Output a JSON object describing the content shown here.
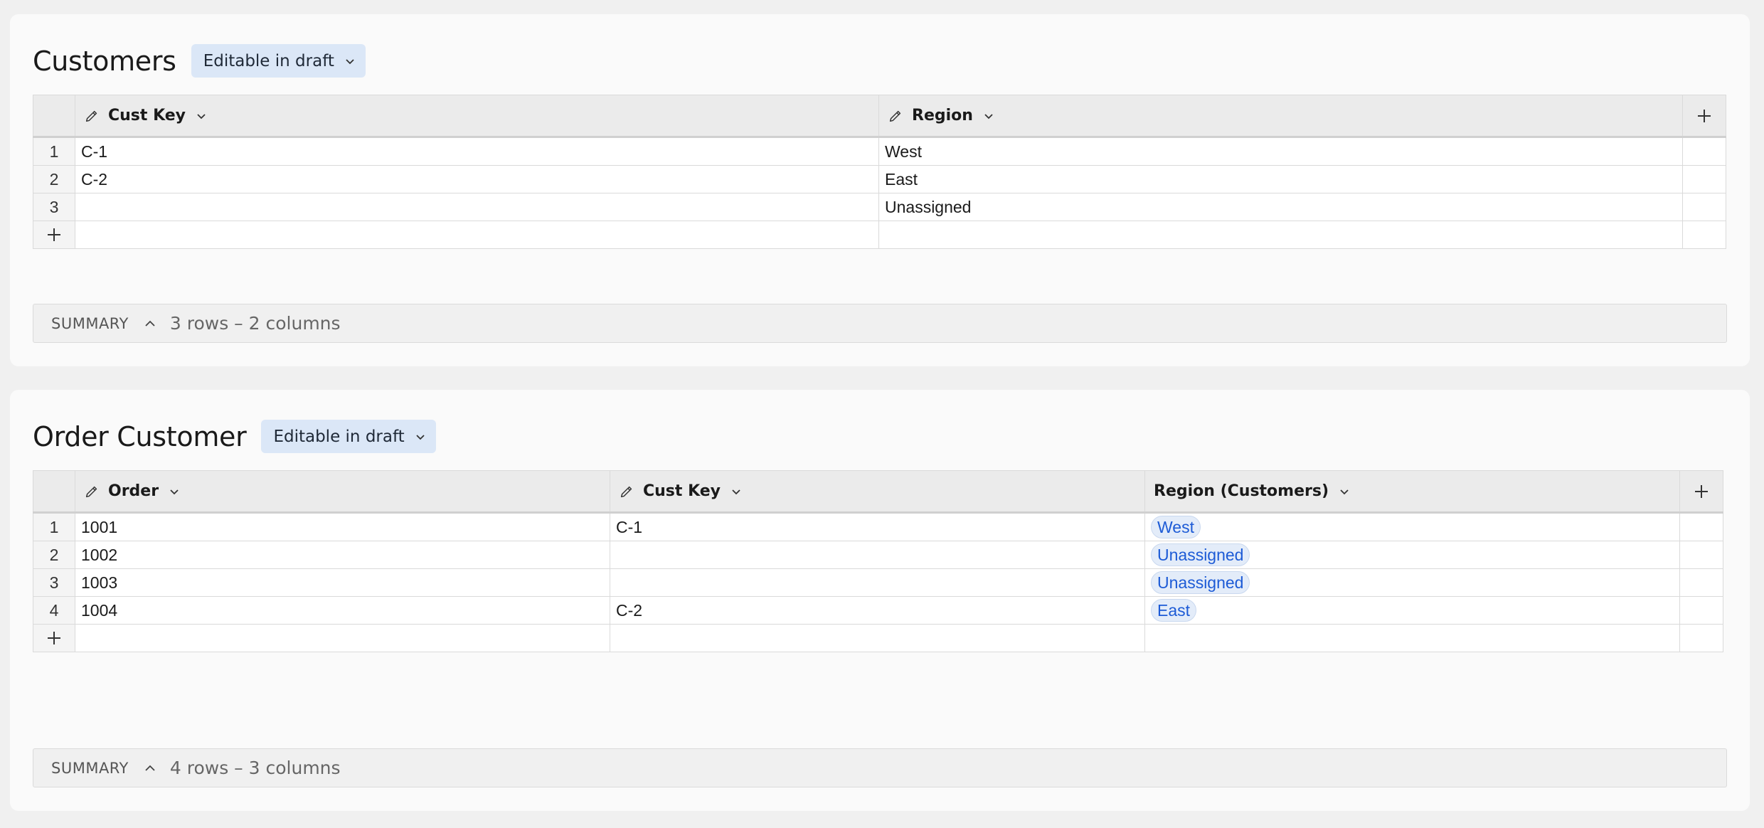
{
  "customers": {
    "title": "Customers",
    "badge": "Editable in draft",
    "columns": [
      "Cust Key",
      "Region"
    ],
    "rows": [
      {
        "num": "1",
        "cust_key": "C-1",
        "region": "West"
      },
      {
        "num": "2",
        "cust_key": "C-2",
        "region": "East"
      },
      {
        "num": "3",
        "cust_key": "",
        "region": "Unassigned"
      }
    ],
    "summary_label": "SUMMARY",
    "summary_info": "3 rows – 2 columns"
  },
  "order_customer": {
    "title": "Order Customer",
    "badge": "Editable in draft",
    "columns": [
      "Order",
      "Cust Key",
      "Region (Customers)"
    ],
    "rows": [
      {
        "num": "1",
        "order": "1001",
        "cust_key": "C-1",
        "region": "West"
      },
      {
        "num": "2",
        "order": "1002",
        "cust_key": "",
        "region": "Unassigned"
      },
      {
        "num": "3",
        "order": "1003",
        "cust_key": "",
        "region": "Unassigned"
      },
      {
        "num": "4",
        "order": "1004",
        "cust_key": "C-2",
        "region": "East"
      }
    ],
    "summary_label": "SUMMARY",
    "summary_info": "4 rows – 3 columns"
  },
  "icons": {
    "pencil": "pencil-icon",
    "chevron": "chevron-down-icon",
    "plus": "plus-icon",
    "collapse": "chevron-up-icon"
  },
  "colors": {
    "badge_bg": "#dbe7f7",
    "pill_text": "#1d5bd6",
    "header_bg": "#ebebeb"
  }
}
